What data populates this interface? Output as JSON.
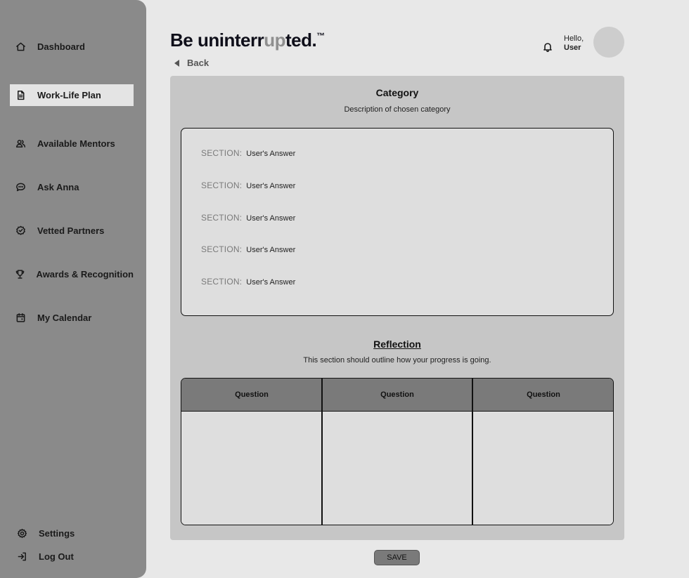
{
  "brand": {
    "part1": "Be uninterr",
    "accent": "up",
    "part2": "ted.",
    "tm": "™"
  },
  "nav": {
    "back_label": "Back",
    "items": [
      {
        "label": "Dashboard",
        "icon": "home-icon"
      },
      {
        "label": "Work-Life Plan",
        "icon": "document-icon",
        "active": true
      },
      {
        "label": "Available Mentors",
        "icon": "users-icon"
      },
      {
        "label": "Ask Anna",
        "icon": "chat-icon"
      },
      {
        "label": "Vetted Partners",
        "icon": "badge-check-icon"
      },
      {
        "label": "Awards & Recognition",
        "icon": "trophy-icon"
      },
      {
        "label": "My Calendar",
        "icon": "calendar-icon"
      }
    ],
    "settings_label": "Settings",
    "logout_label": "Log Out"
  },
  "header": {
    "greeting": "Hello,",
    "user": "User"
  },
  "category": {
    "title": "Category",
    "description": "Description of chosen category",
    "rows": [
      {
        "section": "SECTION:",
        "answer": "User's Answer"
      },
      {
        "section": "SECTION:",
        "answer": "User's Answer"
      },
      {
        "section": "SECTION:",
        "answer": "User's Answer"
      },
      {
        "section": "SECTION:",
        "answer": "User's Answer"
      },
      {
        "section": "SECTION:",
        "answer": "User's Answer"
      }
    ]
  },
  "reflection": {
    "title": "Reflection",
    "description": "This section should outline how your progress is going.",
    "columns": [
      "Question",
      "Question",
      "Question"
    ]
  },
  "save_label": "SAVE"
}
